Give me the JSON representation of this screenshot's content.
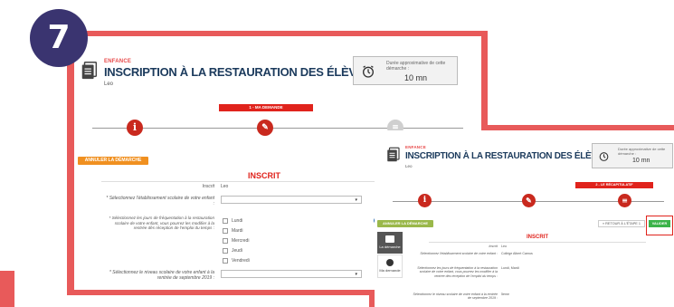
{
  "badge": {
    "number": "7"
  },
  "screen1": {
    "category": "ENFANCE",
    "title": "INSCRIPTION À LA RESTAURATION DES ÉLÈVES 2019-2020",
    "user": "Leo",
    "duration": {
      "label": "Durée approximative de cette démarche :",
      "value": "10 mn"
    },
    "step_banner": "1 - MA DEMANDE",
    "cancel_button": "ANNULER LA DÉMARCHE",
    "section_title": "INSCRIT",
    "fields": {
      "inscrit_label": "Inscrit",
      "inscrit_value": "Leo",
      "school_label": "* Sélectionnez l'établissement scolaire de votre enfant :",
      "days_label": "* Sélectionnez les jours de fréquentation à la restauration scolaire de votre enfant, vous pourrez les modifier à la rentrée dès réception de l'emploi du temps :",
      "days": [
        "Lundi",
        "Mardi",
        "Mercredi",
        "Jeudi",
        "Vendredi"
      ],
      "level_label": "* Sélectionnez le niveau scolaire de votre enfant à la rentrée de septembre 2019 :"
    }
  },
  "screen2": {
    "category": "ENFANCE",
    "title": "INSCRIPTION À LA RESTAURATION DES ÉLÈVES 2019-2020",
    "user": "Leo",
    "duration": {
      "label": "Durée approximative de cette démarche :",
      "value": "10 mn"
    },
    "step_banner": "2 - LE RÉCAPITULATIF",
    "cancel_button": "ANNULER LA DÉMARCHE",
    "back_button": "« RETOUR À L'ÉTAPE 1",
    "validate_button": "VALIDER",
    "section_title": "INSCRIT",
    "side_tabs": [
      "La démarche",
      "Ma demande"
    ],
    "rows": [
      {
        "label": "Inscrit",
        "value": "Leo"
      },
      {
        "label": "Sélectionnez l'établissement scolaire de votre enfant :",
        "value": "Collège Albert Camus"
      },
      {
        "label": "Sélectionnez les jours de fréquentation à la restauration scolaire de votre enfant, vous pourrez les modifier à la rentrée dès réception de l'emploi du temps :",
        "value": "Lundi, Mardi"
      },
      {
        "label": "Sélectionnez le niveau scolaire de votre enfant à la rentrée de septembre 2019 :",
        "value": "5ème"
      }
    ]
  },
  "colors": {
    "red": "#e85a5a",
    "badge": "#3a3470",
    "navy": "#1b3a5c",
    "orange": "#f09020",
    "green": "#3cb34a"
  }
}
